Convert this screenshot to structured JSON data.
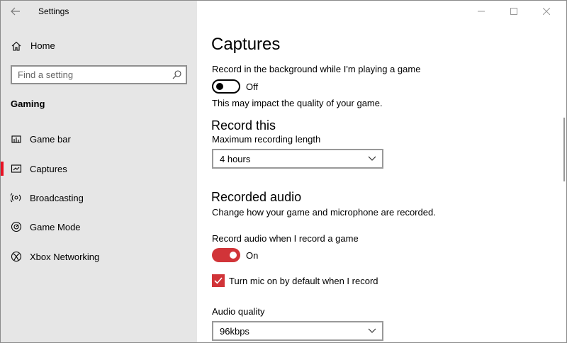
{
  "window": {
    "title": "Settings",
    "controls": {
      "minimize": "minimize",
      "maximize": "maximize",
      "close": "close"
    }
  },
  "sidebar": {
    "home_label": "Home",
    "search_placeholder": "Find a setting",
    "section_title": "Gaming",
    "items": [
      {
        "label": "Game bar",
        "icon": "game-bar-icon",
        "active": false
      },
      {
        "label": "Captures",
        "icon": "captures-icon",
        "active": true
      },
      {
        "label": "Broadcasting",
        "icon": "broadcasting-icon",
        "active": false
      },
      {
        "label": "Game Mode",
        "icon": "game-mode-icon",
        "active": false
      },
      {
        "label": "Xbox Networking",
        "icon": "xbox-icon",
        "active": false
      }
    ]
  },
  "content": {
    "title": "Captures",
    "background_recording": {
      "label": "Record in the background while I'm playing a game",
      "state": "Off",
      "note": "This may impact the quality of your game."
    },
    "record_this": {
      "heading": "Record this",
      "max_length_label": "Maximum recording length",
      "max_length_value": "4 hours"
    },
    "recorded_audio": {
      "heading": "Recorded audio",
      "description": "Change how your game and microphone are recorded.",
      "record_audio_label": "Record audio when I record a game",
      "record_audio_state": "On",
      "mic_checkbox_label": "Turn mic on by default when I record",
      "mic_checked": true,
      "quality_label": "Audio quality",
      "quality_value": "96kbps"
    }
  },
  "colors": {
    "accent": "#d13438",
    "sidebar_bg": "#e6e6e6",
    "active_indicator": "#e81123"
  }
}
